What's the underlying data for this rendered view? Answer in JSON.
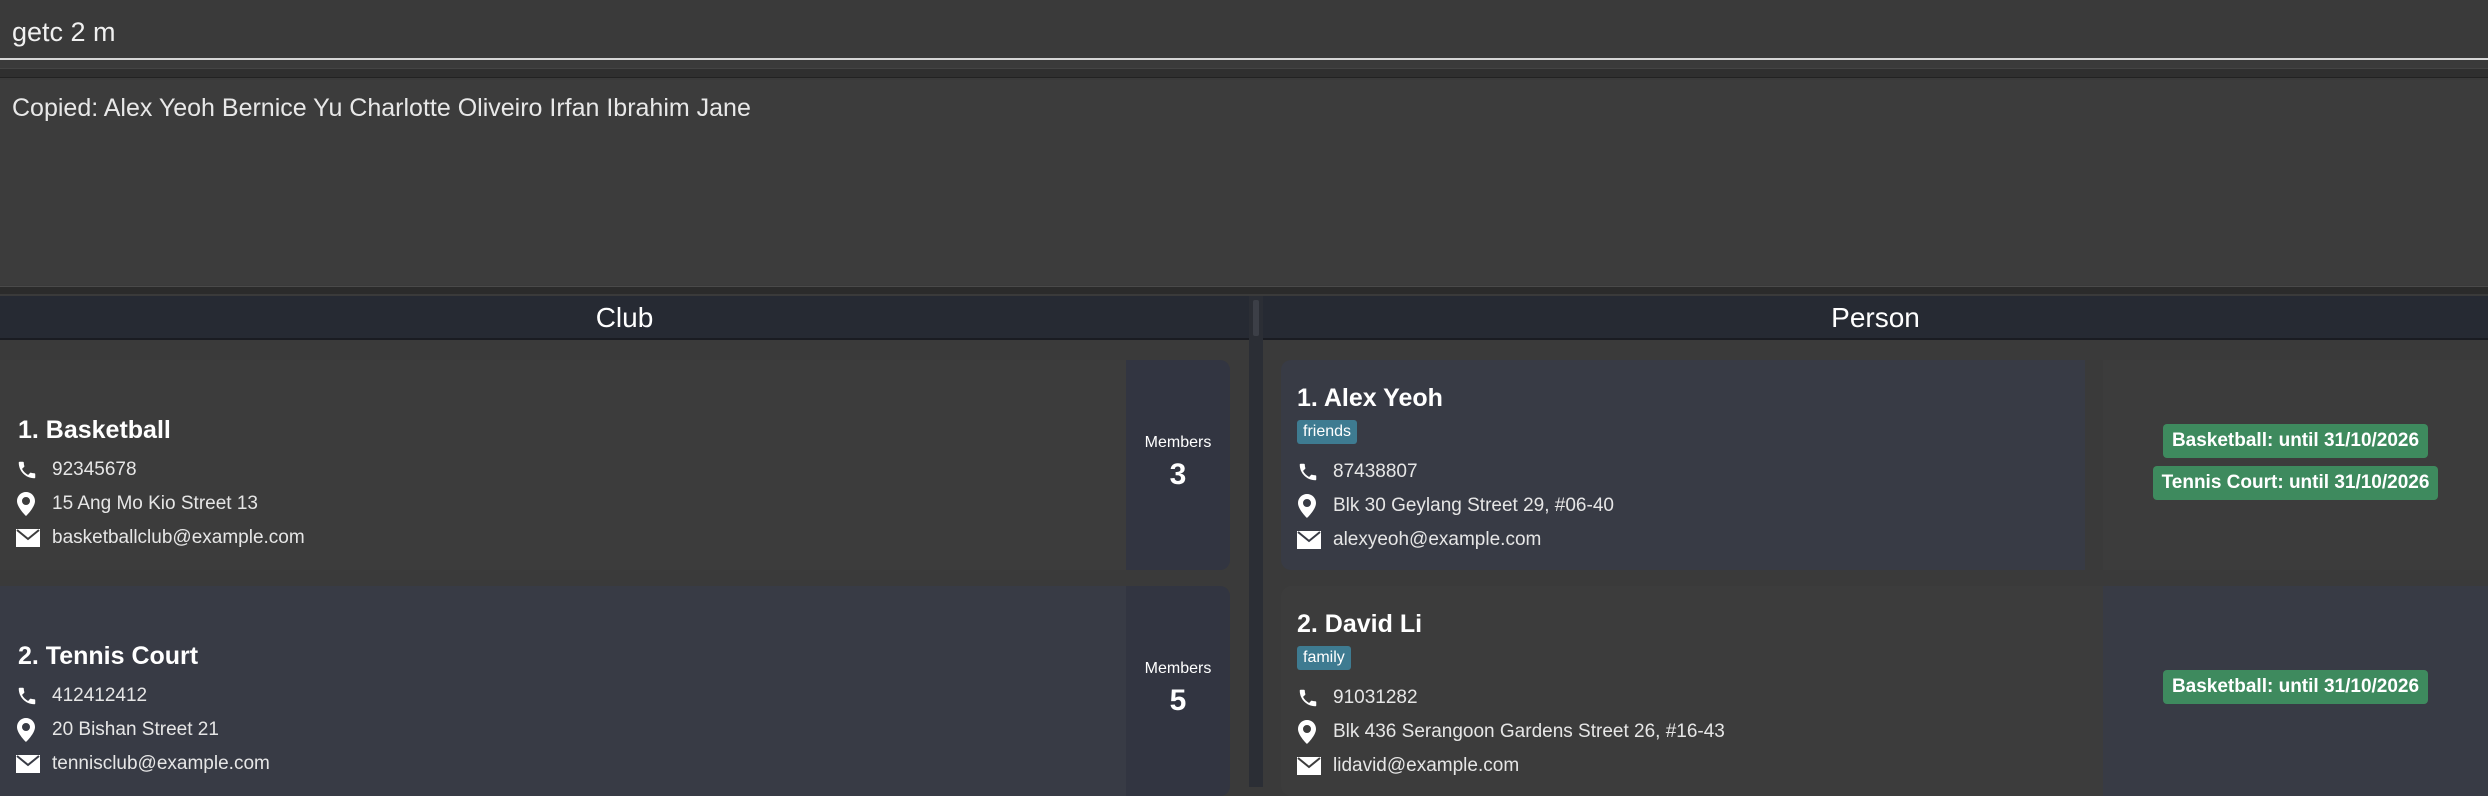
{
  "command": {
    "value": "getc 2 m"
  },
  "result": {
    "text": "Copied: Alex Yeoh Bernice Yu Charlotte Oliveiro Irfan Ibrahim Jane"
  },
  "headers": {
    "club": "Club",
    "person": "Person"
  },
  "members_label": "Members",
  "clubs": [
    {
      "title": "1. Basketball",
      "phone": "92345678",
      "address": "15 Ang Mo Kio Street 13",
      "email": "basketballclub@example.com",
      "members": "3"
    },
    {
      "title": "2. Tennis Court",
      "phone": "412412412",
      "address": "20 Bishan Street 21",
      "email": "tennisclub@example.com",
      "members": "5"
    }
  ],
  "persons": [
    {
      "title": "1. Alex Yeoh",
      "tag": "friends",
      "phone": "87438807",
      "address": "Blk 30 Geylang Street 29, #06-40",
      "email": "alexyeoh@example.com",
      "memberships": [
        "Basketball: until 31/10/2026",
        "Tennis Court: until 31/10/2026"
      ]
    },
    {
      "title": "2. David Li",
      "tag": "family",
      "phone": "91031282",
      "address": "Blk 436 Serangoon Gardens Street 26, #16-43",
      "email": "lidavid@example.com",
      "memberships": [
        "Basketball: until 31/10/2026"
      ]
    }
  ],
  "colors": {
    "card_dark": "#383b45",
    "card_light": "#3c3c3c",
    "tag": "#3e7b91",
    "membership": "#3e8a5e",
    "header": "#262a33"
  },
  "icons": {
    "phone": "phone-icon",
    "address": "location-pin-icon",
    "email": "envelope-icon"
  }
}
